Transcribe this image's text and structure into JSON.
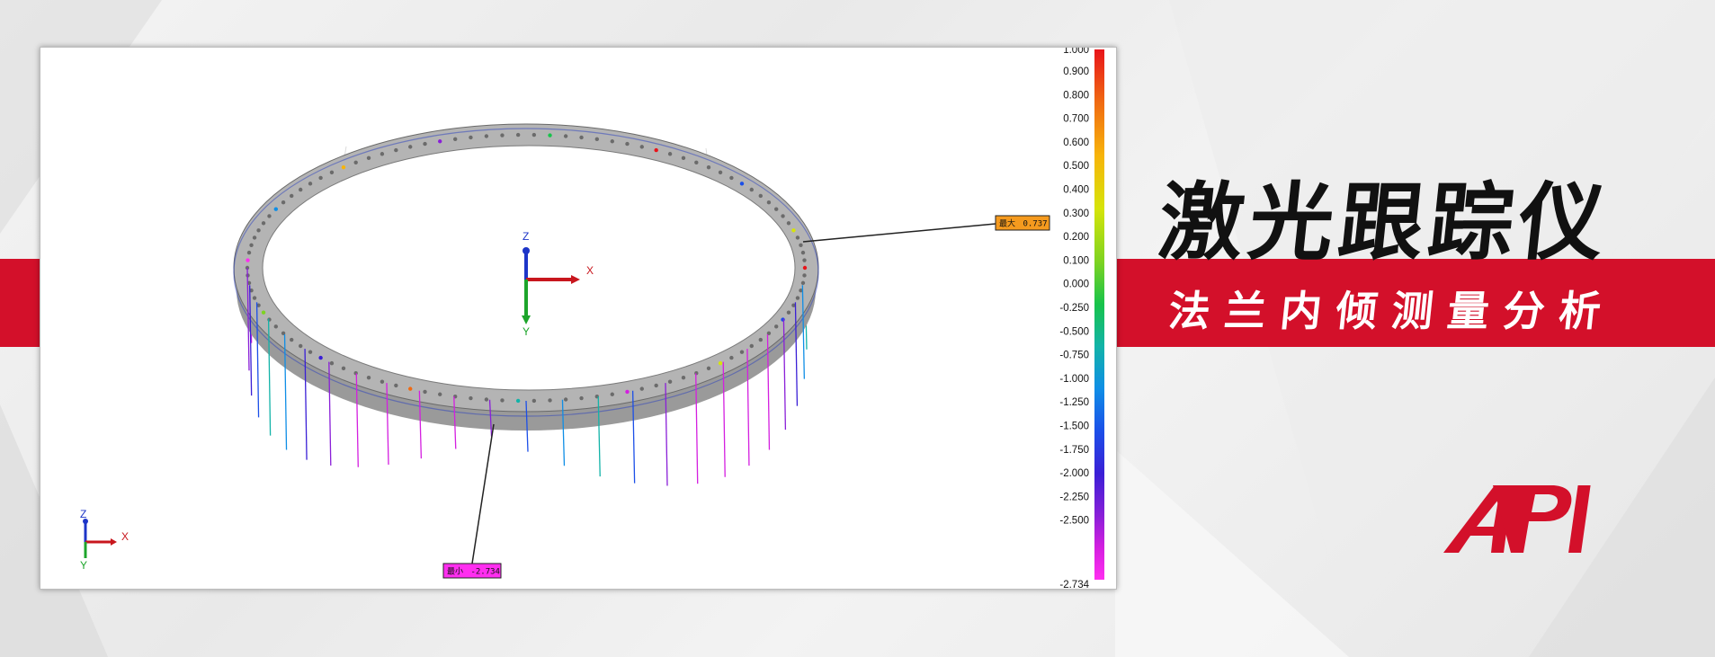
{
  "banner": {
    "title": "激光跟踪仪",
    "subtitle": "法兰内倾测量分析",
    "brand": "API"
  },
  "viewport": {
    "axis_labels": {
      "x": "X",
      "y": "Y",
      "z": "Z"
    },
    "callouts": {
      "max": {
        "label": "最大",
        "value": "0.737"
      },
      "min": {
        "label": "最小",
        "value": "-2.734"
      }
    }
  },
  "color_scale": {
    "top_label": "1.000",
    "labels": [
      "0.900",
      "0.800",
      "0.700",
      "0.600",
      "0.500",
      "0.400",
      "0.300",
      "0.200",
      "0.100",
      "0.000",
      "-0.250",
      "-0.500",
      "-0.750",
      "-1.000",
      "-1.250",
      "-1.500",
      "-1.750",
      "-2.000",
      "-2.250",
      "-2.500"
    ],
    "bottom_label": "-2.734",
    "colors": [
      "#e8141a",
      "#f06a12",
      "#f7b40a",
      "#d6e40a",
      "#7ed321",
      "#17c34a",
      "#12b3a8",
      "#0f8ee6",
      "#1b4fe8",
      "#3a1fd6",
      "#8a1fd8",
      "#d41fe0",
      "#ff2ef0"
    ]
  },
  "colors": {
    "brand_red": "#d3102a",
    "ring_gray": "#a9a9a9"
  }
}
